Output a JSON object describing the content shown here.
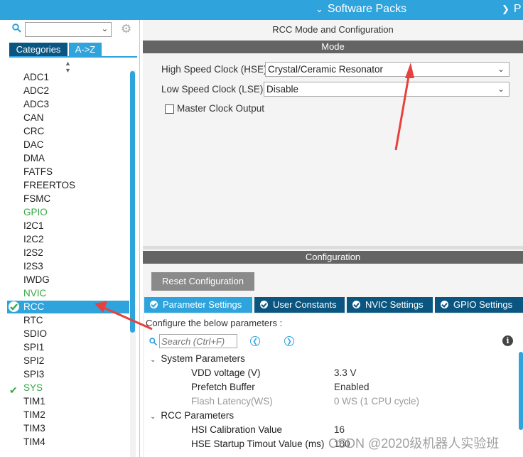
{
  "header": {
    "software_packs": "Software Packs",
    "next_menu": "P"
  },
  "left_panel": {
    "search_value": "",
    "tabs": [
      "Categories",
      "A->Z"
    ],
    "items": [
      "ADC1",
      "ADC2",
      "ADC3",
      "CAN",
      "CRC",
      "DAC",
      "DMA",
      "FATFS",
      "FREERTOS",
      "FSMC",
      "GPIO",
      "I2C1",
      "I2C2",
      "I2S2",
      "I2S3",
      "IWDG",
      "NVIC",
      "RCC",
      "RTC",
      "SDIO",
      "SPI1",
      "SPI2",
      "SPI3",
      "SYS",
      "TIM1",
      "TIM2",
      "TIM3",
      "TIM4"
    ]
  },
  "right_panel": {
    "title": "RCC Mode and Configuration",
    "mode_header": "Mode",
    "hse_label": "High Speed Clock (HSE)",
    "hse_value": "Crystal/Ceramic Resonator",
    "lse_label": "Low Speed Clock (LSE)",
    "lse_value": "Disable",
    "mco_label": "Master Clock Output",
    "config_header": "Configuration",
    "reset_button": "Reset Configuration",
    "tabs": [
      "Parameter Settings",
      "User Constants",
      "NVIC Settings",
      "GPIO Settings"
    ],
    "configure_text": "Configure the below parameters :",
    "search_placeholder": "Search (Ctrl+F)",
    "groups": [
      {
        "name": "System Parameters",
        "params": [
          {
            "name": "VDD voltage (V)",
            "value": "3.3 V"
          },
          {
            "name": "Prefetch Buffer",
            "value": "Enabled"
          },
          {
            "name": "Flash Latency(WS)",
            "value": "0 WS (1 CPU cycle)"
          }
        ]
      },
      {
        "name": "RCC Parameters",
        "params": [
          {
            "name": "HSI Calibration Value",
            "value": "16"
          },
          {
            "name": "HSE Startup Timout Value (ms)",
            "value": "100"
          }
        ]
      }
    ]
  },
  "watermark": "CSDN @2020级机器人实验班",
  "colors": {
    "accent": "#2fa3dc",
    "dark_tab": "#0b5680",
    "header_gray": "#646464",
    "enabled_green": "#34a843",
    "annotation_red": "#e8413b"
  },
  "icons": {
    "search": "search-icon",
    "settings": "gear-icon",
    "check": "check-icon",
    "info": "info-icon"
  }
}
